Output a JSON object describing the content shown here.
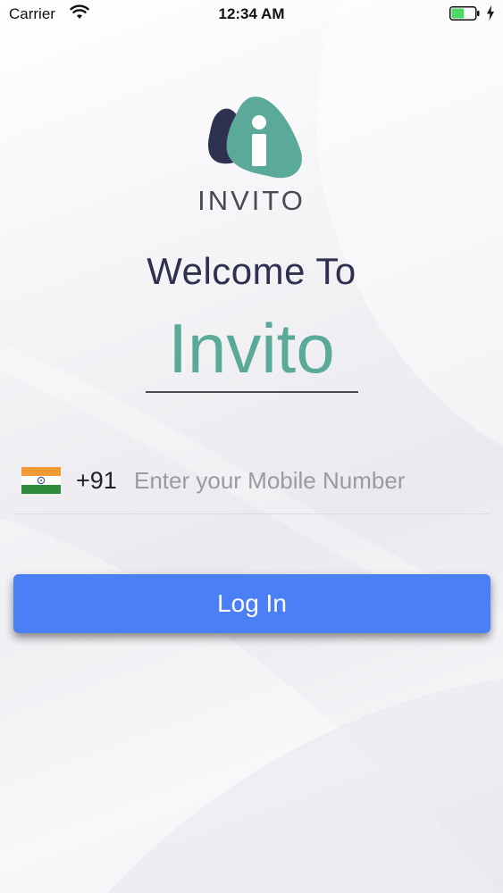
{
  "status_bar": {
    "carrier": "Carrier",
    "time": "12:34 AM",
    "wifi_icon": "wifi-icon",
    "battery_icon": "battery-icon",
    "charging_icon": "lightning-bolt-icon",
    "battery_level": 0.55
  },
  "logo": {
    "icon": "invito-logo-icon",
    "text": "INVITO"
  },
  "welcome": {
    "title": "Welcome To",
    "app_name": "Invito"
  },
  "phone": {
    "flag_icon": "india-flag-icon",
    "country_code": "+91",
    "placeholder": "Enter your Mobile Number",
    "value": ""
  },
  "login": {
    "label": "Log In"
  },
  "colors": {
    "accent": "#4a7ff6",
    "brand_green": "#5aa999",
    "brand_navy": "#2f3150",
    "battery_green": "#4cd964"
  }
}
